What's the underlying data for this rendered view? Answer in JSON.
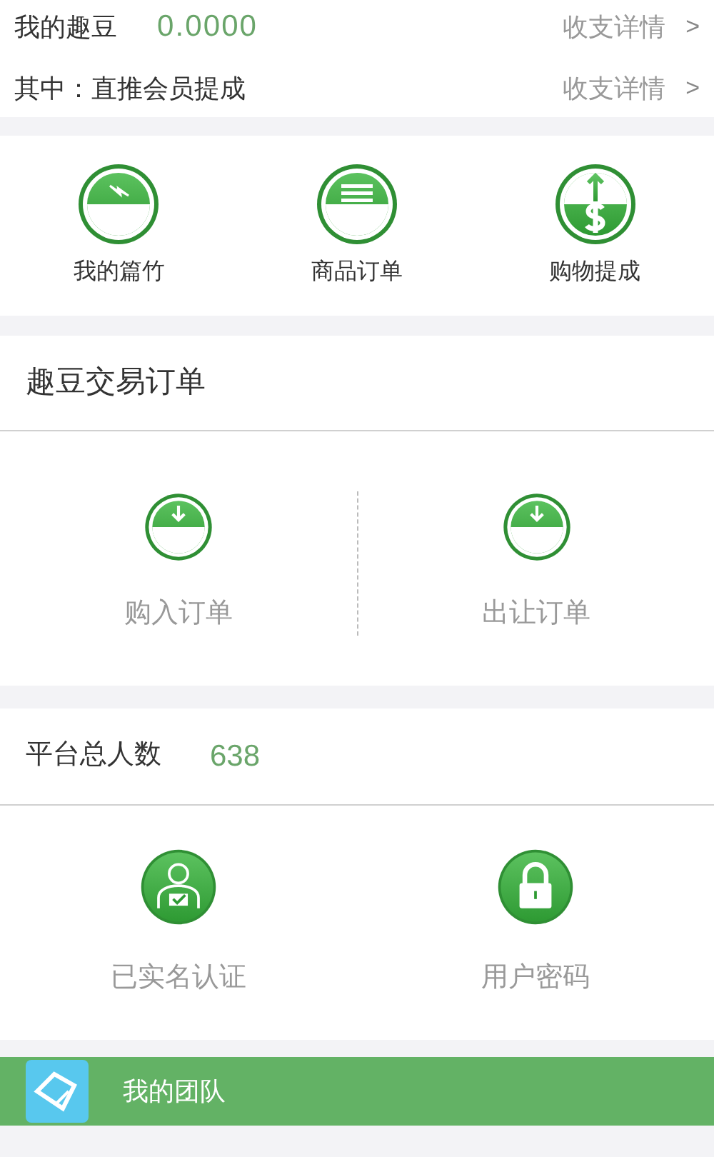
{
  "balance": {
    "label": "我的趣豆",
    "value": "0.0000",
    "link": "收支详情",
    "chevron": ">"
  },
  "commission": {
    "label": "其中：直推会员提成",
    "link": "收支详情",
    "chevron": ">"
  },
  "shortcuts": [
    {
      "label": "我的篇竹"
    },
    {
      "label": "商品订单"
    },
    {
      "label": "购物提成"
    }
  ],
  "orders": {
    "title": "趣豆交易订单",
    "items": [
      {
        "label": "购入订单"
      },
      {
        "label": "出让订单"
      }
    ]
  },
  "platform": {
    "label": "平台总人数",
    "value": "638"
  },
  "account": [
    {
      "label": "已实名认证"
    },
    {
      "label": "用户密码"
    }
  ],
  "team_bar": {
    "label": "我的团队"
  }
}
